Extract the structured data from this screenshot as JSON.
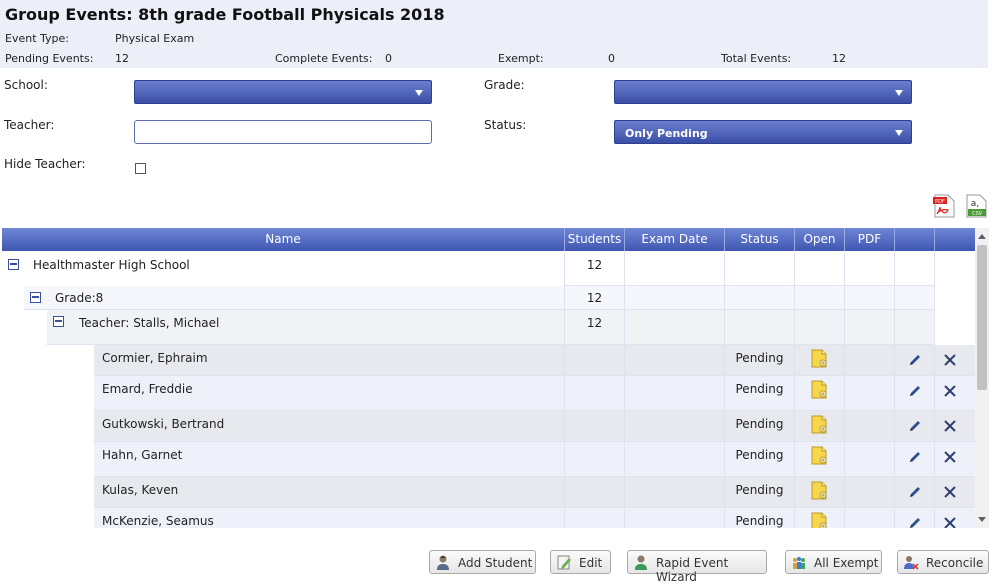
{
  "header": {
    "title": "Group Events: 8th grade Football Physicals 2018",
    "event_type_label": "Event Type:",
    "event_type_value": "Physical Exam",
    "pending_label": "Pending Events:",
    "pending_value": "12",
    "complete_label": "Complete Events:",
    "complete_value": "0",
    "exempt_label": "Exempt:",
    "exempt_value": "0",
    "total_label": "Total Events:",
    "total_value": "12"
  },
  "filters": {
    "school_label": "School:",
    "school_value": "",
    "grade_label": "Grade:",
    "grade_value": "",
    "teacher_label": "Teacher:",
    "teacher_value": "",
    "status_label": "Status:",
    "status_value": "Only Pending",
    "hide_teacher_label": "Hide Teacher:"
  },
  "grid": {
    "columns": [
      "Name",
      "Students",
      "Exam Date",
      "Status",
      "Open",
      "PDF",
      "",
      ""
    ],
    "school": {
      "name": "Healthmaster High School",
      "students": "12"
    },
    "grade": {
      "name": "Grade:8",
      "students": "12"
    },
    "teacher": {
      "name": "Teacher: Stalls, Michael",
      "students": "12"
    },
    "students": [
      {
        "name": "Cormier, Ephraim",
        "status": "Pending"
      },
      {
        "name": "Emard, Freddie",
        "status": "Pending"
      },
      {
        "name": "Gutkowski, Bertrand",
        "status": "Pending"
      },
      {
        "name": "Hahn, Garnet",
        "status": "Pending"
      },
      {
        "name": "Kulas, Keven",
        "status": "Pending"
      },
      {
        "name": "McKenzie, Seamus",
        "status": "Pending"
      }
    ]
  },
  "buttons": {
    "add_student": "Add Student",
    "edit": "Edit",
    "rapid_event_wizard": "Rapid Event Wizard",
    "all_exempt": "All Exempt",
    "reconcile": "Reconcile"
  },
  "colors": {
    "header_bg": "#eceef8",
    "accent": "#3e56b0",
    "row_alt": "#eef1fa"
  }
}
